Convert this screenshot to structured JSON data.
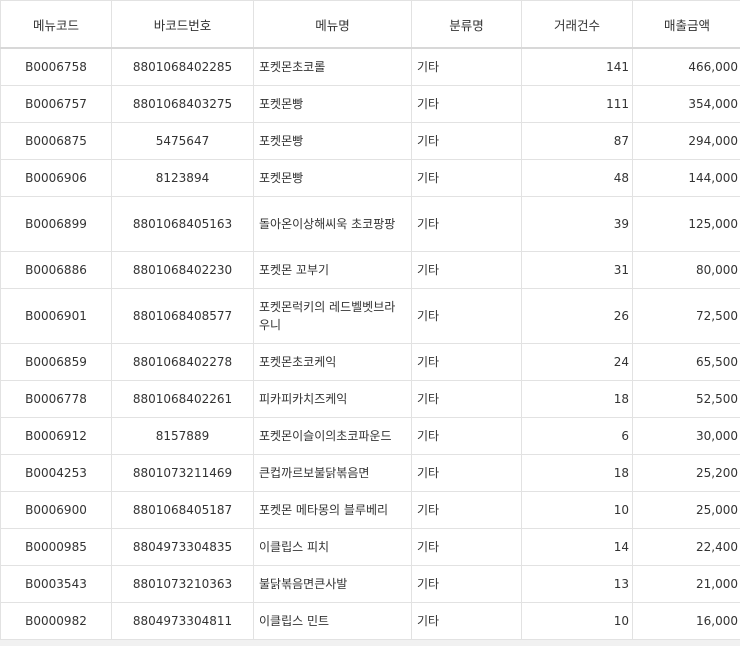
{
  "columns": [
    "메뉴코드",
    "바코드번호",
    "메뉴명",
    "분류명",
    "거래건수",
    "매출금액"
  ],
  "rows": [
    [
      "B0006758",
      "8801068402285",
      "포켓몬초코롤",
      "기타",
      "141",
      "466,000"
    ],
    [
      "B0006757",
      "8801068403275",
      "포켓몬빵",
      "기타",
      "111",
      "354,000"
    ],
    [
      "B0006875",
      "5475647",
      "포켓몬빵",
      "기타",
      "87",
      "294,000"
    ],
    [
      "B0006906",
      "8123894",
      "포켓몬빵",
      "기타",
      "48",
      "144,000"
    ],
    [
      "B0006899",
      "8801068405163",
      "돌아온이상해씨욱 초코팡팡",
      "기타",
      "39",
      "125,000"
    ],
    [
      "B0006886",
      "8801068402230",
      "포켓몬 꼬부기",
      "기타",
      "31",
      "80,000"
    ],
    [
      "B0006901",
      "8801068408577",
      "포켓몬럭키의 레드벨벳브라우니",
      "기타",
      "26",
      "72,500"
    ],
    [
      "B0006859",
      "8801068402278",
      "포켓몬초코케익",
      "기타",
      "24",
      "65,500"
    ],
    [
      "B0006778",
      "8801068402261",
      "피카피카치즈케익",
      "기타",
      "18",
      "52,500"
    ],
    [
      "B0006912",
      "8157889",
      "포켓몬이슬이의초코파운드",
      "기타",
      "6",
      "30,000"
    ],
    [
      "B0004253",
      "8801073211469",
      "큰컵까르보불닭볶음면",
      "기타",
      "18",
      "25,200"
    ],
    [
      "B0006900",
      "8801068405187",
      "포켓몬 메타몽의 블루베리",
      "기타",
      "10",
      "25,000"
    ],
    [
      "B0000985",
      "8804973304835",
      "이클립스 피치",
      "기타",
      "14",
      "22,400"
    ],
    [
      "B0003543",
      "8801073210363",
      "불닭볶음면큰사발",
      "기타",
      "13",
      "21,000"
    ],
    [
      "B0000982",
      "8804973304811",
      "이클립스 민트",
      "기타",
      "10",
      "16,000"
    ]
  ]
}
